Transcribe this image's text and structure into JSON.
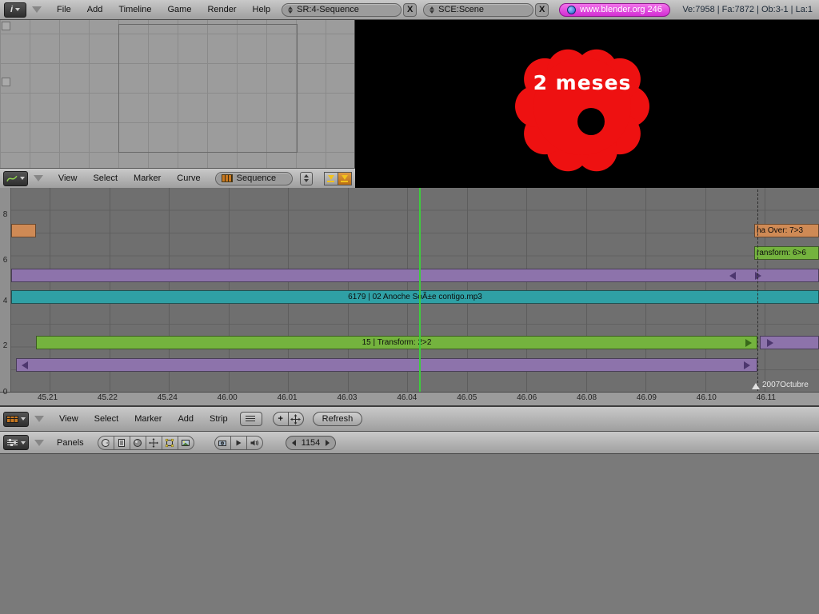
{
  "topbar": {
    "menus": [
      "File",
      "Add",
      "Timeline",
      "Game",
      "Render",
      "Help"
    ],
    "screen": "SR:4-Sequence",
    "scene": "SCE:Scene",
    "link": "www.blender.org 246",
    "stats": "Ve:7958 | Fa:7872 | Ob:3-1 | La:1",
    "close_label": "X"
  },
  "ipo": {
    "menus": [
      "View",
      "Select",
      "Marker",
      "Curve"
    ],
    "mode": "Sequence"
  },
  "preview": {
    "caption": "2 meses"
  },
  "timeline": {
    "channels": [
      "8",
      "6",
      "4",
      "2",
      "0"
    ],
    "ruler": [
      "45.21",
      "45.22",
      "45.24",
      "46.00",
      "46.01",
      "46.03",
      "46.04",
      "46.05",
      "46.06",
      "46.08",
      "46.09",
      "46.10",
      "46.11"
    ],
    "marker": "2007Octubre",
    "strips": {
      "alpha_over": "ha Over: 7>3",
      "transform_top": "ransform: 6>6",
      "audio": "6179 | 02 Anoche SoÃ±e contigo.mp3",
      "transform_main": "15 | Transform: 2>2"
    }
  },
  "vse": {
    "menus": [
      "View",
      "Select",
      "Marker",
      "Add",
      "Strip"
    ],
    "refresh": "Refresh",
    "zoom_label": "+"
  },
  "buttons": {
    "panels": "Panels",
    "frame": "1154"
  },
  "colors": {
    "strip-orange": "#cf8a55",
    "strip-green": "#74b33e",
    "strip-purple": "#8d73ab",
    "strip-audio": "#2fa0a5",
    "frame-line": "#3ecb3e",
    "flower-red": "#ee1111",
    "link-bg": "#d32ed3"
  }
}
